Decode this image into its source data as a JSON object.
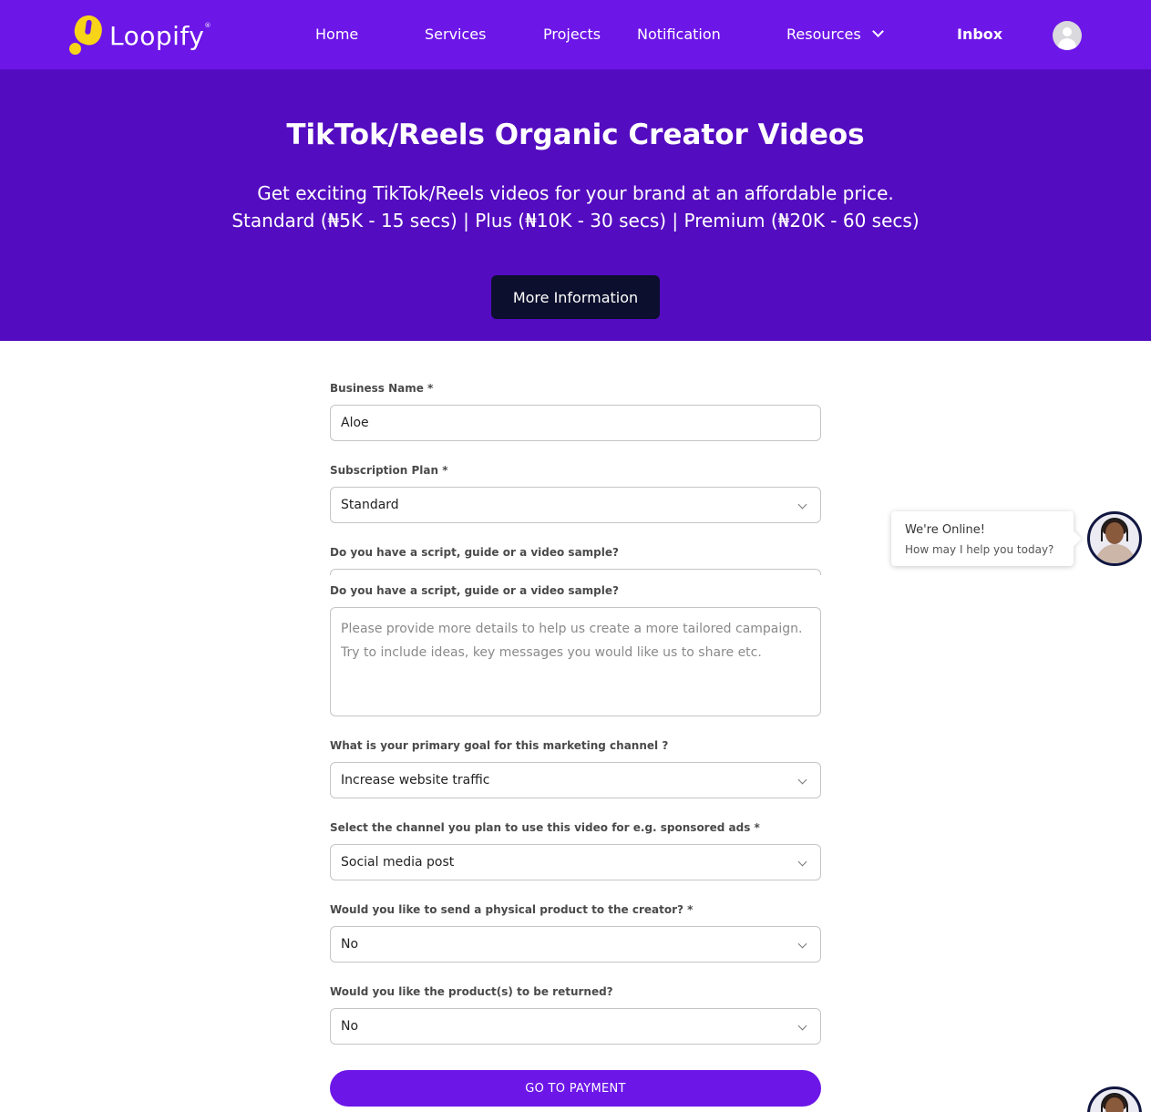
{
  "nav": {
    "brand": "Loopify",
    "brand_mark": "®",
    "links": {
      "home": "Home",
      "services": "Services",
      "projects": "Projects",
      "notification": "Notification",
      "resources": "Resources",
      "inbox": "Inbox"
    }
  },
  "hero": {
    "title": "TikTok/Reels Organic Creator Videos",
    "subtitle_line1": "Get exciting TikTok/Reels videos for your brand at an affordable price.",
    "subtitle_line2": "Standard (₦5K - 15 secs) | Plus (₦10K - 30 secs) | Premium (₦20K - 60 secs)",
    "button": "More Information"
  },
  "form": {
    "business_name_label": "Business Name *",
    "business_name_value": "Aloe",
    "plan_label": "Subscription Plan *",
    "plan_value": "Standard",
    "script_label": "Do you have a script, guide or a video sample?",
    "details_label": "Do you have a script, guide or a video sample?",
    "details_placeholder_line1": "Please provide more details to help us create a more tailored campaign.",
    "details_placeholder_line2": "Try to include ideas, key messages you would like us to share etc.",
    "goal_label": "What is your primary goal for this marketing channel ?",
    "goal_value": "Increase website traffic",
    "channel_label": "Select the channel you plan to use this video for e.g. sponsored ads *",
    "channel_value": "Social media post",
    "physical_label": "Would you like to send a physical product to the creator? *",
    "physical_value": "No",
    "returned_label": "Would you like the product(s) to be returned?",
    "returned_value": "No",
    "submit": "GO TO PAYMENT"
  },
  "chat": {
    "title": "We're Online!",
    "subtitle": "How may I help you today?"
  },
  "colors": {
    "nav_bg": "#6d16e8",
    "hero_bg": "#540cc0",
    "hero_button": "#0c0f2d",
    "logo_yellow": "#f7d417",
    "submit_bg": "#6d16e8"
  },
  "icons": {
    "logo": "loopify-logo-icon",
    "resources_dropdown": "chevron-down-icon",
    "profile": "user-avatar-icon",
    "select_caret": "chevron-down-icon",
    "chat_agent": "support-agent-avatar"
  }
}
